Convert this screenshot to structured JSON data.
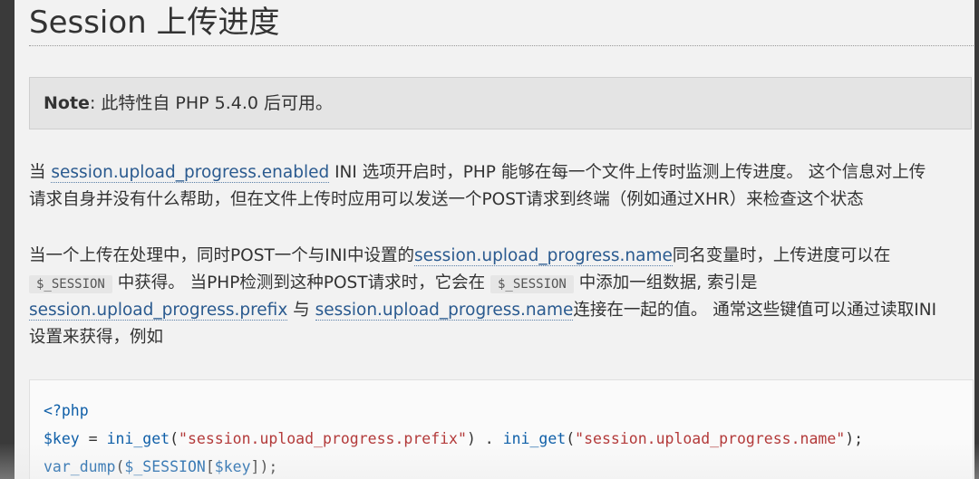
{
  "section": {
    "title": "Session 上传进度"
  },
  "note": {
    "label": "Note",
    "text": ": 此特性自 PHP 5.4.0 后可用。"
  },
  "para1": {
    "prefix": "当 ",
    "link": "session.upload_progress.enabled",
    "line1_rest": " INI 选项开启时，PHP 能够在每一个文件上传时监测上传进度。 这个信息对上传",
    "line2": "请求自身并没有什么帮助，但在文件上传时应用可以发送一个POST请求到终端（例如通过XHR）来检查这个状态"
  },
  "para2": {
    "line1_prefix": "当一个上传在处理中，同时POST一个与INI中设置的",
    "line1_link": "session.upload_progress.name",
    "line1_rest": "同名变量时，上传进度可以在",
    "code1": "$_SESSION",
    "line2_mid": " 中获得。 当PHP检测到这种POST请求时，它会在 ",
    "code2": "$_SESSION",
    "line2_rest": " 中添加一组数据, 索引是",
    "line3_link1": "session.upload_progress.prefix",
    "line3_mid": " 与 ",
    "line3_link2": "session.upload_progress.name",
    "line3_rest": "连接在一起的值。 通常这些键值可以通过读取INI",
    "line4": "设置来获得，例如"
  },
  "code": {
    "open_tag": "<?php",
    "var_key": "$key",
    "assign": " = ",
    "fn_ini_get_1": "ini_get",
    "arg1": "\"session.upload_progress.prefix\"",
    "concat": " . ",
    "fn_ini_get_2": "ini_get",
    "arg2": "\"session.upload_progress.name\"",
    "end1": ");",
    "fn_var_dump": "var_dump",
    "session_var": "$_SESSION",
    "key_var": "$key",
    "end2": "]);"
  }
}
